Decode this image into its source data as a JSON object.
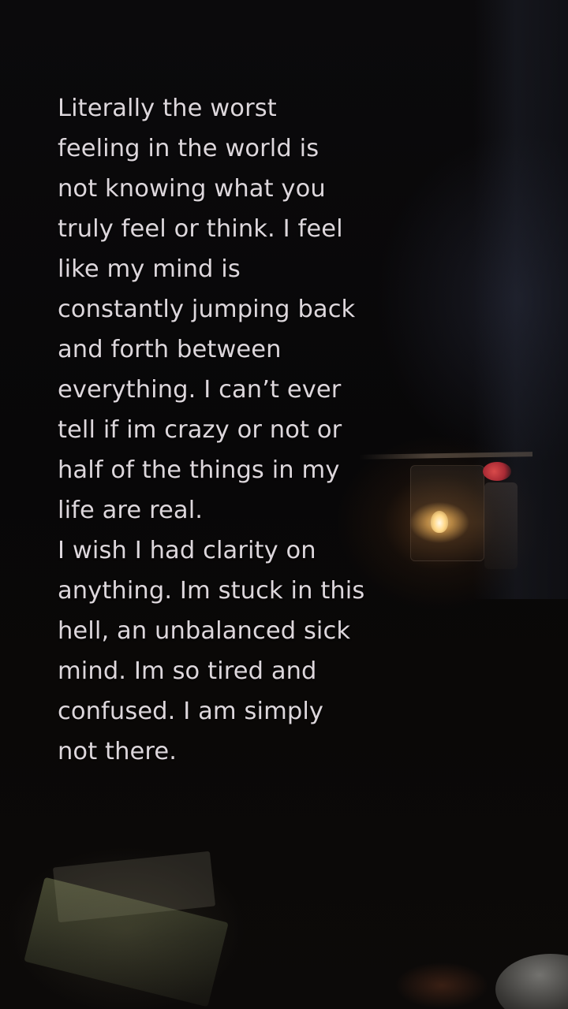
{
  "story": {
    "lines": [
      "Literally the worst",
      "feeling in the world is",
      "not knowing what you",
      "truly feel or think. I feel",
      "like my mind is",
      "constantly jumping back",
      "and forth between",
      "everything. I can’t ever",
      "tell if im crazy or not or",
      "half of the things in my",
      "life are real.",
      "I wish I had clarity on",
      "anything. Im stuck in this",
      "hell, an unbalanced sick",
      "mind. Im so tired and",
      "confused. I am simply",
      "not there."
    ]
  },
  "colors": {
    "text": "#ddd7dc",
    "background": "#060606",
    "candle_glow": "#ffd98a"
  }
}
